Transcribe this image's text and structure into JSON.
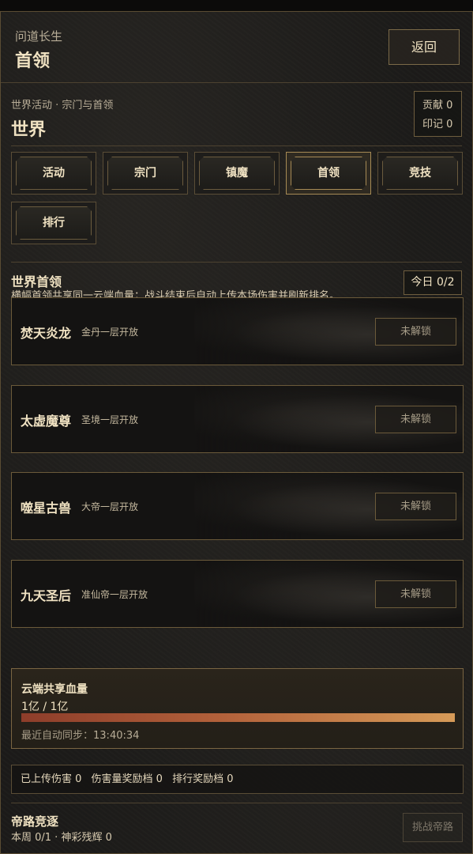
{
  "header": {
    "app_name": "问道长生",
    "page_title": "首领",
    "back_label": "返回"
  },
  "world": {
    "breadcrumb": "世界活动 · 宗门与首领",
    "title": "世界",
    "contribution": "贡献 0",
    "seal": "印记 0"
  },
  "tabs": [
    {
      "label": "活动",
      "active": false
    },
    {
      "label": "宗门",
      "active": false
    },
    {
      "label": "镇魔",
      "active": false
    },
    {
      "label": "首领",
      "active": true
    },
    {
      "label": "竞技",
      "active": false
    },
    {
      "label": "排行",
      "active": false
    }
  ],
  "boss_section": {
    "heading": "世界首领",
    "description": "横幅首领共享同一云端血量；战斗结束后自动上传本场伤害并刷新排名。",
    "today": "今日 0/2"
  },
  "bosses": [
    {
      "name": "焚天炎龙",
      "requirement": "金丹一层开放",
      "status": "未解锁"
    },
    {
      "name": "太虚魔尊",
      "requirement": "圣境一层开放",
      "status": "未解锁"
    },
    {
      "name": "噬星古兽",
      "requirement": "大帝一层开放",
      "status": "未解锁"
    },
    {
      "name": "九天圣后",
      "requirement": "准仙帝一层开放",
      "status": "未解锁"
    }
  ],
  "hp": {
    "title": "云端共享血量",
    "value": "1亿 / 1亿",
    "fill_percent": 100,
    "sync_label": "最近自动同步：",
    "sync_time": "13:40:34"
  },
  "stats": {
    "uploaded": "已上传伤害 0",
    "damage_tier": "伤害量奖励档 0",
    "rank_tier": "排行奖励档 0"
  },
  "emperor": {
    "title": "帝路竞逐",
    "info": "本周 0/1 · 神彩残辉 0",
    "button": "挑战帝路"
  }
}
